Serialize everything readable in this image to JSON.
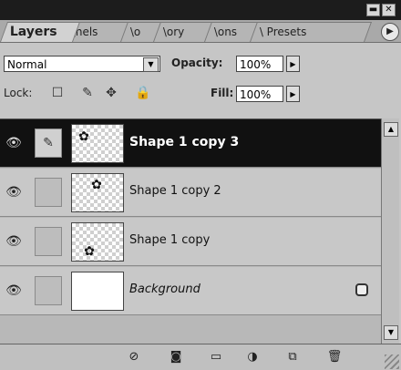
{
  "window": {
    "collapse_glyph": "▬",
    "close_glyph": "✕"
  },
  "tabs": [
    {
      "label": "Layers",
      "active": true
    },
    {
      "label": "\\nels"
    },
    {
      "label": "\\o"
    },
    {
      "label": "\\ory"
    },
    {
      "label": "\\ons"
    },
    {
      "label": "\\ Presets"
    }
  ],
  "tab_menu_glyph": "▶",
  "blend": {
    "mode": "Normal",
    "dropdown_glyph": "▼",
    "opacity_label": "Opacity:",
    "opacity_value": "100%",
    "stepper_glyph": "▶"
  },
  "lock": {
    "label": "Lock:",
    "fill_label": "Fill:",
    "fill_value": "100%",
    "icons": {
      "transparent": "☐",
      "brush": "✎",
      "move": "✥",
      "all": "🔒"
    }
  },
  "layers": [
    {
      "name": "Shape 1 copy 3",
      "selected": true,
      "italic": false,
      "thumb": "checker",
      "gear_pos": "top-left",
      "eye": "👁",
      "brush_link": "✎"
    },
    {
      "name": "Shape 1 copy 2",
      "selected": false,
      "italic": false,
      "thumb": "checker",
      "gear_pos": "top-center",
      "eye": "👁",
      "brush_link": ""
    },
    {
      "name": "Shape 1 copy",
      "selected": false,
      "italic": false,
      "thumb": "checker",
      "gear_pos": "bottom-center",
      "eye": "👁",
      "brush_link": ""
    },
    {
      "name": "Background",
      "selected": false,
      "italic": true,
      "thumb": "white",
      "gear_pos": "none",
      "eye": "👁",
      "brush_link": "",
      "locked": true
    }
  ],
  "gear_glyph": "✿",
  "scroll": {
    "up": "▲",
    "down": "▼"
  },
  "bottom_tools": [
    {
      "icon": "layer-style-icon",
      "glyph": "⊘"
    },
    {
      "icon": "layer-mask-icon",
      "glyph": "◙"
    },
    {
      "icon": "new-group-icon",
      "glyph": "▭"
    },
    {
      "icon": "adjustment-layer-icon",
      "glyph": "◑"
    },
    {
      "icon": "new-layer-icon",
      "glyph": "⧉"
    },
    {
      "icon": "trash-icon",
      "glyph": "🗑"
    }
  ]
}
